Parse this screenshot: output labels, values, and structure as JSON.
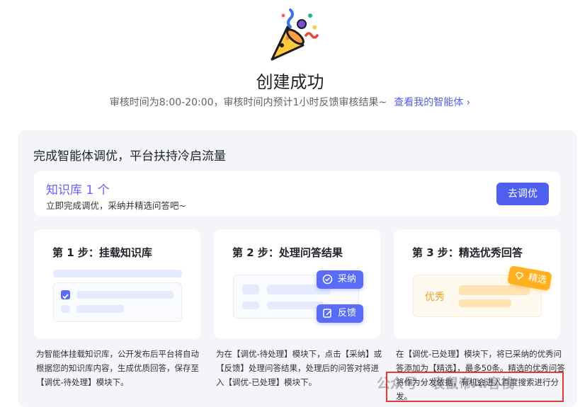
{
  "header": {
    "title": "创建成功",
    "subtitle": "审核时间为8:00-20:00，审核时间内预计1小时反馈审核结果~",
    "link_label": "查看我的智能体 ›"
  },
  "panel": {
    "title": "完成智能体调优，平台扶持冷启流量",
    "kb_card": {
      "title": "知识库 1 个",
      "subtitle": "立即完成调优，采纳并精选问答吧~",
      "button_label": "去调优"
    },
    "steps": [
      {
        "title": "第 1 步：挂载知识库",
        "desc": "为智能体挂载知识库，公开发布后平台将自动根据您的知识库内容，生成优质回答，保存至【调优-待处理】模块下。"
      },
      {
        "title": "第 2 步：处理问答结果",
        "desc": "为在【调优-待处理】模块下，点击【采纳】或【反馈】处理问答结果，处理后的问答对将进入【调优-已处理】模块下。",
        "chips": [
          "采纳",
          "反馈"
        ]
      },
      {
        "title": "第 3 步：精选优秀回答",
        "desc": "在【调优-已处理】模块下，将已采纳的优秀问答添加为【精选】，最多50条。精选的优秀问答将作为分发依据，有机会进入百度搜索进行分发。",
        "badge": "精选",
        "excellent_label": "优秀"
      }
    ]
  },
  "watermark": "公众号 · 袁鼠帝AI客栈",
  "colors": {
    "accent": "#4e5ff0",
    "kb_title": "#6a5cff",
    "annotation": "#e03a3a",
    "badge": "#ffb020"
  }
}
